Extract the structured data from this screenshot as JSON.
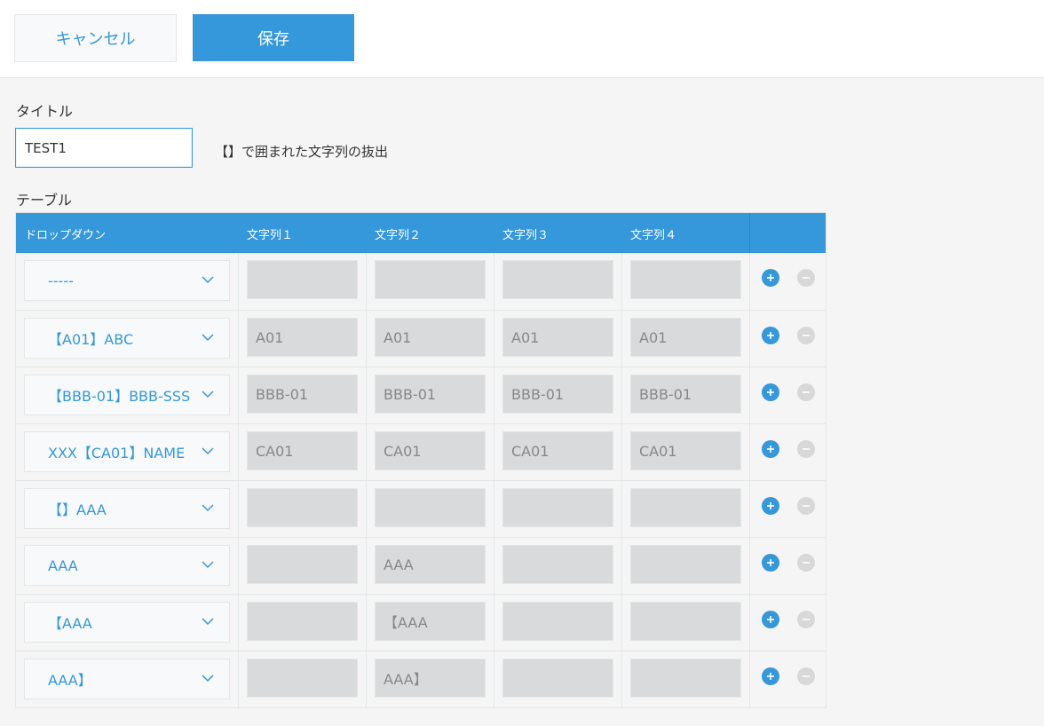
{
  "toolbar": {
    "cancel_label": "キャンセル",
    "save_label": "保存"
  },
  "form": {
    "title_label": "タイトル",
    "title_value": "TEST1",
    "note": "【】で囲まれた文字列の抜出",
    "table_label": "テーブル"
  },
  "table": {
    "headers": {
      "dropdown": "ドロップダウン",
      "col1": "文字列１",
      "col2": "文字列２",
      "col3": "文字列３",
      "col4": "文字列４"
    },
    "rows": [
      {
        "dropdown": "-----",
        "c1": "",
        "c2": "",
        "c3": "",
        "c4": ""
      },
      {
        "dropdown": "【A01】ABC",
        "c1": "A01",
        "c2": "A01",
        "c3": "A01",
        "c4": "A01"
      },
      {
        "dropdown": "【BBB-01】BBB-SSS",
        "c1": "BBB-01",
        "c2": "BBB-01",
        "c3": "BBB-01",
        "c4": "BBB-01"
      },
      {
        "dropdown": "XXX【CA01】NAME",
        "c1": "CA01",
        "c2": "CA01",
        "c3": "CA01",
        "c4": "CA01"
      },
      {
        "dropdown": "【】AAA",
        "c1": "",
        "c2": "",
        "c3": "",
        "c4": ""
      },
      {
        "dropdown": "AAA",
        "c1": "",
        "c2": "AAA",
        "c3": "",
        "c4": ""
      },
      {
        "dropdown": "【AAA",
        "c1": "",
        "c2": "【AAA",
        "c3": "",
        "c4": ""
      },
      {
        "dropdown": "AAA】",
        "c1": "",
        "c2": "AAA】",
        "c3": "",
        "c4": ""
      }
    ]
  },
  "colors": {
    "accent": "#3498db",
    "background": "#f5f5f5",
    "readonly_field": "#d8dadb",
    "remove_disabled": "#d8d8d8"
  },
  "icons": {
    "dropdown": "chevron-down-icon",
    "add": "plus-circle-icon",
    "remove": "minus-circle-icon"
  }
}
